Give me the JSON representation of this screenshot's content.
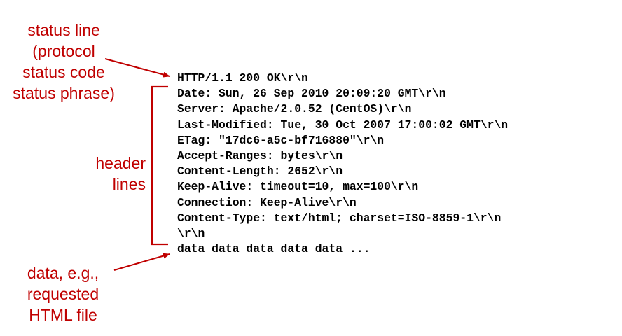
{
  "annotations": {
    "status_line": [
      "status line",
      "(protocol",
      "status code",
      "status phrase)"
    ],
    "header_lines": [
      "header",
      "lines"
    ],
    "data": [
      "data, e.g.,",
      "requested",
      "HTML file"
    ]
  },
  "message": {
    "status_line": "HTTP/1.1 200 OK\\r\\n",
    "headers": [
      "Date: Sun, 26 Sep 2010 20:09:20 GMT\\r\\n",
      "Server: Apache/2.0.52 (CentOS)\\r\\n",
      "Last-Modified: Tue, 30 Oct 2007 17:00:02 GMT\\r\\n",
      "ETag: \"17dc6-a5c-bf716880\"\\r\\n",
      "Accept-Ranges: bytes\\r\\n",
      "Content-Length: 2652\\r\\n",
      "Keep-Alive: timeout=10, max=100\\r\\n",
      "Connection: Keep-Alive\\r\\n",
      "Content-Type: text/html; charset=ISO-8859-1\\r\\n",
      "\\r\\n"
    ],
    "body": "data data data data data ..."
  },
  "colors": {
    "annotation": "#c00000",
    "text": "#000000"
  }
}
